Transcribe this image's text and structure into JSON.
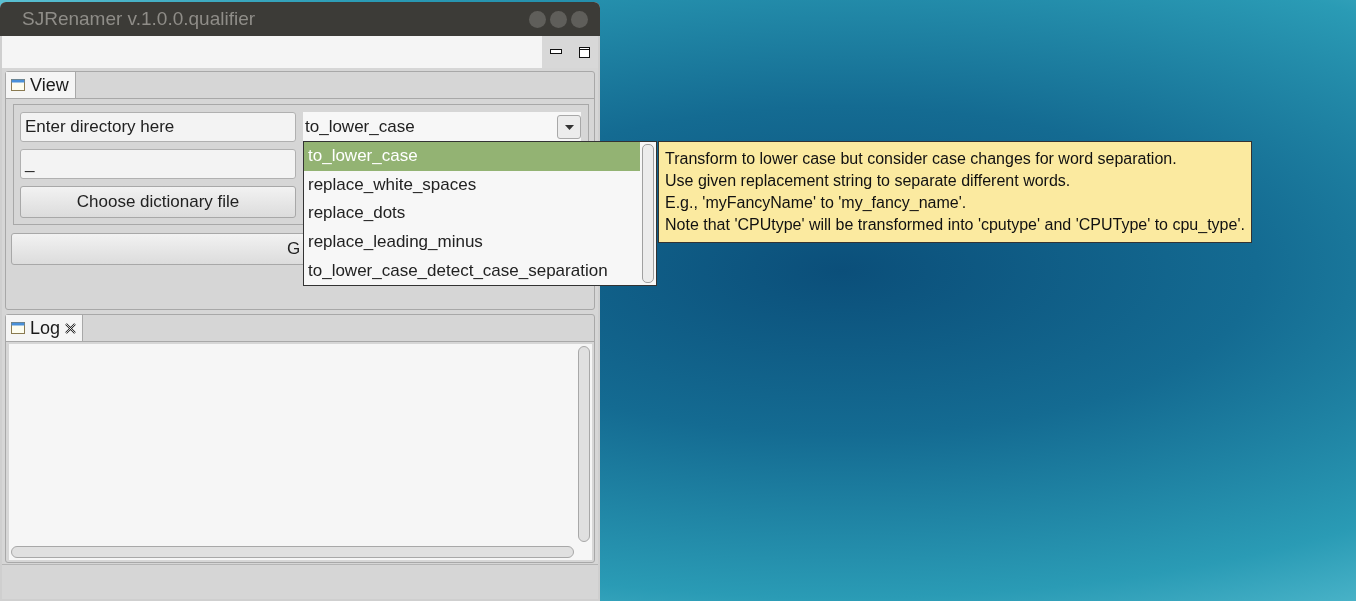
{
  "window": {
    "title": "SJRenamer v.1.0.0.qualifier"
  },
  "view_tab": {
    "label": "View",
    "selected": true
  },
  "directory_field": {
    "value": "Enter directory here"
  },
  "separator_field": {
    "value": "_"
  },
  "choose_button": {
    "label": "Choose dictionary file"
  },
  "go_button": {
    "label": "G"
  },
  "mode_combo": {
    "value": "to_lower_case",
    "expanded": true,
    "options": [
      {
        "label": "to_lower_case",
        "selected": true
      },
      {
        "label": "replace_white_spaces",
        "selected": false
      },
      {
        "label": "replace_dots",
        "selected": false
      },
      {
        "label": "replace_leading_minus",
        "selected": false
      },
      {
        "label": "to_lower_case_detect_case_separation",
        "selected": false
      }
    ]
  },
  "tooltip": {
    "lines": [
      "Transform to lower case but consider case changes for word separation.",
      "Use given replacement string to separate different words.",
      "E.g., 'myFancyName' to 'my_fancy_name'.",
      "Note that 'CPUtype' will be transformed into 'cputype' and 'CPUType' to cpu_type'."
    ]
  },
  "log_tab": {
    "label": "Log",
    "selected": true
  }
}
